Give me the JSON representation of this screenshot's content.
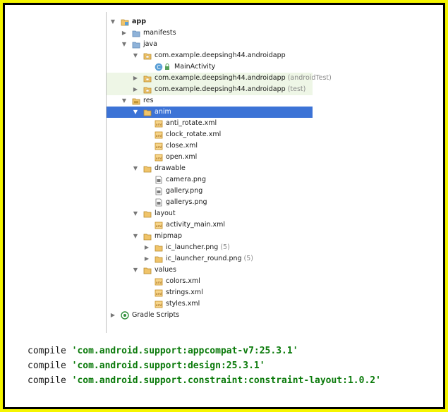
{
  "tree": {
    "app": "app",
    "manifests": "manifests",
    "java": "java",
    "pkg_main": "com.example.deepsingh44.androidapp",
    "main_activity": "MainActivity",
    "pkg_android_test": "com.example.deepsingh44.androidapp",
    "pkg_android_test_suffix": "(androidTest)",
    "pkg_test": "com.example.deepsingh44.androidapp",
    "pkg_test_suffix": "(test)",
    "res": "res",
    "anim": "anim",
    "anim_files": [
      "anti_rotate.xml",
      "clock_rotate.xml",
      "close.xml",
      "open.xml"
    ],
    "drawable": "drawable",
    "drawable_files": [
      "camera.png",
      "gallery.png",
      "gallerys.png"
    ],
    "layout": "layout",
    "layout_files": [
      "activity_main.xml"
    ],
    "mipmap": "mipmap",
    "mipmap_files": [
      {
        "name": "ic_launcher.png",
        "count": "(5)"
      },
      {
        "name": "ic_launcher_round.png",
        "count": "(5)"
      }
    ],
    "values": "values",
    "values_files": [
      "colors.xml",
      "strings.xml",
      "styles.xml"
    ],
    "gradle": "Gradle Scripts"
  },
  "icons": {
    "folder": "folder-icon",
    "package": "package-icon",
    "class": "class-icon",
    "xml": "xml-file-icon",
    "image": "image-file-icon",
    "gradle": "gradle-icon"
  },
  "colors": {
    "selection": "#3c73d6",
    "test_highlight": "#eef6e6",
    "string_literal": "#0a7a0a",
    "frame_outer": "#f5f500"
  },
  "code": {
    "keyword": "compile",
    "lines": [
      "'com.android.support:appcompat-v7:25.3.1'",
      "'com.android.support:design:25.3.1'",
      "'com.android.support.constraint:constraint-layout:1.0.2'"
    ]
  }
}
